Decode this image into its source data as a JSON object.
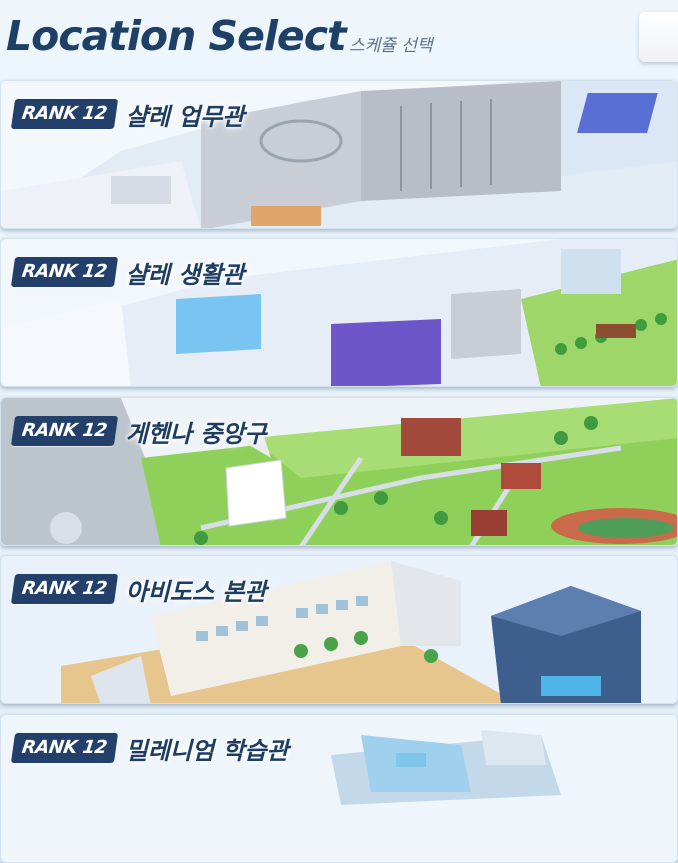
{
  "header": {
    "title": "Location Select",
    "subtitle": "스케쥴 선택"
  },
  "locations": [
    {
      "rank": "RANK 12",
      "name": "샬레 업무관"
    },
    {
      "rank": "RANK 12",
      "name": "샬레 생활관"
    },
    {
      "rank": "RANK 12",
      "name": "게헨나 중앙구"
    },
    {
      "rank": "RANK 12",
      "name": "아비도스 본관"
    },
    {
      "rank": "RANK 12",
      "name": "밀레니엄 학습관"
    }
  ],
  "colors": {
    "title": "#1e3f66",
    "badge": "#23406a",
    "background": "#eef6fc"
  }
}
